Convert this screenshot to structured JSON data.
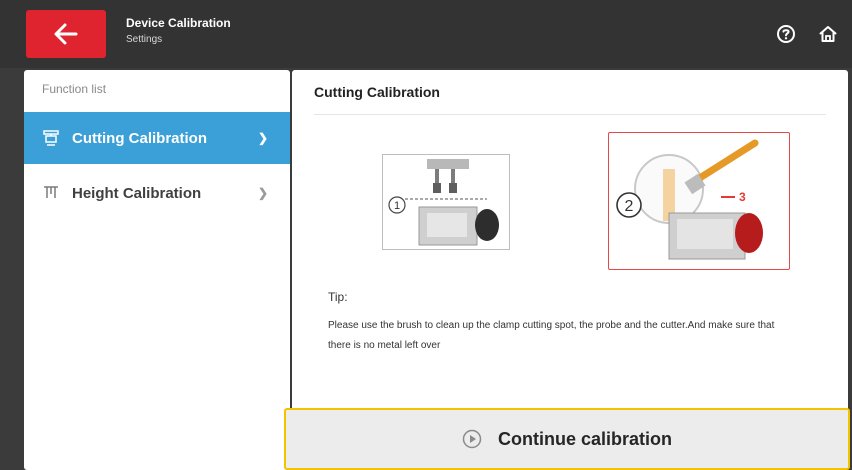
{
  "header": {
    "title": "Device Calibration",
    "subtitle": "Settings",
    "back_icon": "arrow-left-icon",
    "help_icon": "question-circle-icon",
    "home_icon": "home-icon",
    "accent": "#e0242f"
  },
  "sidebar": {
    "heading": "Function list",
    "items": [
      {
        "label": "Cutting Calibration",
        "icon": "cutting-calibration-icon",
        "active": true
      },
      {
        "label": "Height Calibration",
        "icon": "height-calibration-icon",
        "active": false
      }
    ],
    "active_color": "#3b9fd8"
  },
  "main": {
    "title": "Cutting Calibration",
    "steps": [
      {
        "number": "1"
      },
      {
        "number": "2",
        "marker": "3"
      }
    ],
    "tip_label": "Tip:",
    "tip_text": "Please use the brush to clean up the clamp cutting spot, the probe and the cutter.And make sure that there is no metal left over"
  },
  "footer": {
    "continue_label": "Continue calibration",
    "play_icon": "play-circle-icon",
    "highlight_color": "#f3c200"
  }
}
